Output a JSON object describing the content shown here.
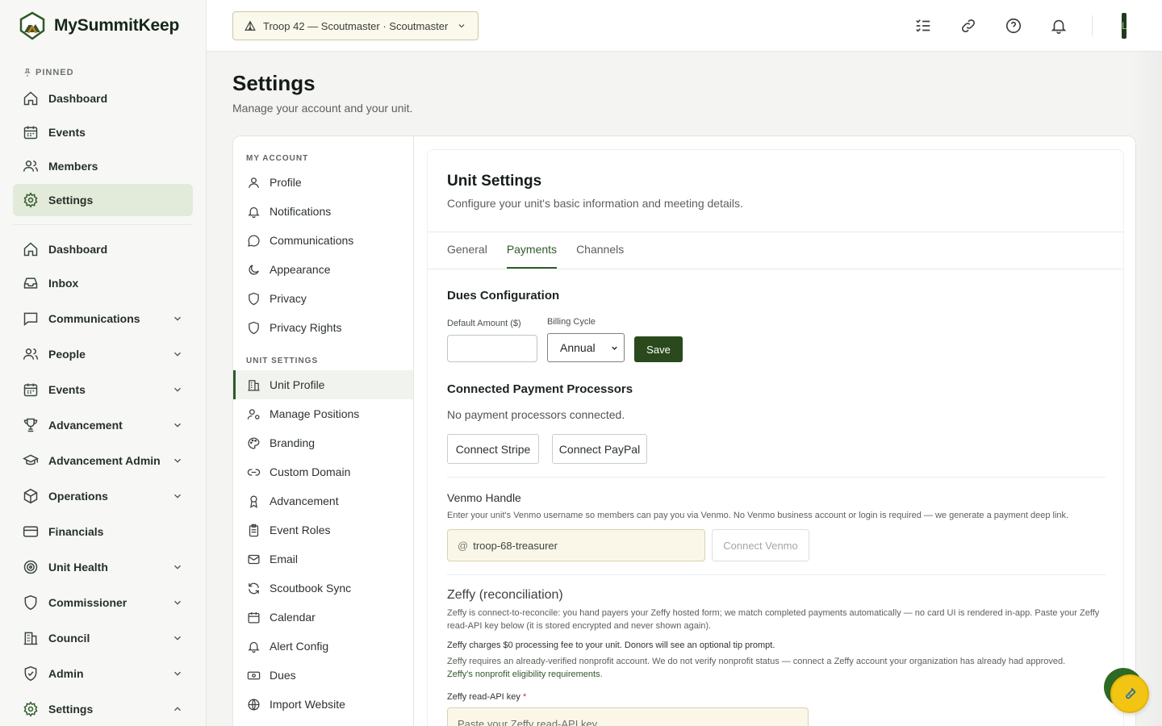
{
  "brand": {
    "name": "MySummitKeep"
  },
  "sidebar": {
    "pinned_label": "PINNED",
    "pinned": [
      {
        "label": "Dashboard",
        "icon": "home-icon"
      },
      {
        "label": "Events",
        "icon": "calendar-icon"
      },
      {
        "label": "Members",
        "icon": "users-icon"
      },
      {
        "label": "Settings",
        "icon": "gear-icon",
        "active": true
      }
    ],
    "items": [
      {
        "label": "Dashboard",
        "icon": "home-icon",
        "expandable": false
      },
      {
        "label": "Inbox",
        "icon": "inbox-icon",
        "expandable": false
      },
      {
        "label": "Communications",
        "icon": "message-icon",
        "expandable": true
      },
      {
        "label": "People",
        "icon": "users-icon",
        "expandable": true
      },
      {
        "label": "Events",
        "icon": "calendar-icon",
        "expandable": true
      },
      {
        "label": "Advancement",
        "icon": "trophy-icon",
        "expandable": true
      },
      {
        "label": "Advancement Admin",
        "icon": "graduation-cap-icon",
        "expandable": true
      },
      {
        "label": "Operations",
        "icon": "box-icon",
        "expandable": true
      },
      {
        "label": "Financials",
        "icon": "credit-card-icon",
        "expandable": false
      },
      {
        "label": "Unit Health",
        "icon": "target-icon",
        "expandable": true
      },
      {
        "label": "Commissioner",
        "icon": "shield-icon",
        "expandable": true
      },
      {
        "label": "Council",
        "icon": "building-icon",
        "expandable": true
      },
      {
        "label": "Admin",
        "icon": "shield-check-icon",
        "expandable": true
      },
      {
        "label": "Settings",
        "icon": "gear-icon",
        "expandable": true,
        "expanded": true
      }
    ]
  },
  "topbar": {
    "unit_selector": "Troop 42 — Scoutmaster · Scoutmaster",
    "icons": [
      "checklist-icon",
      "link-icon",
      "help-icon",
      "bell-icon"
    ],
    "avatar_initial": "L"
  },
  "page": {
    "title": "Settings",
    "subtitle": "Manage your account and your unit."
  },
  "settings_nav": {
    "my_account_label": "MY ACCOUNT",
    "my_account": [
      {
        "label": "Profile",
        "icon": "user-icon"
      },
      {
        "label": "Notifications",
        "icon": "bell-icon"
      },
      {
        "label": "Communications",
        "icon": "chat-bubble-icon"
      },
      {
        "label": "Appearance",
        "icon": "moon-icon"
      },
      {
        "label": "Privacy",
        "icon": "shield-icon"
      },
      {
        "label": "Privacy Rights",
        "icon": "shield-icon"
      }
    ],
    "unit_settings_label": "UNIT SETTINGS",
    "unit_settings": [
      {
        "label": "Unit Profile",
        "icon": "building-icon",
        "active": true
      },
      {
        "label": "Manage Positions",
        "icon": "user-cog-icon"
      },
      {
        "label": "Branding",
        "icon": "palette-icon"
      },
      {
        "label": "Custom Domain",
        "icon": "link-icon"
      },
      {
        "label": "Advancement",
        "icon": "award-icon"
      },
      {
        "label": "Event Roles",
        "icon": "clipboard-icon"
      },
      {
        "label": "Email",
        "icon": "mail-icon"
      },
      {
        "label": "Scoutbook Sync",
        "icon": "refresh-icon"
      },
      {
        "label": "Calendar",
        "icon": "calendar-icon"
      },
      {
        "label": "Alert Config",
        "icon": "bell-icon"
      },
      {
        "label": "Dues",
        "icon": "banknote-icon"
      },
      {
        "label": "Import Website",
        "icon": "globe-icon"
      }
    ]
  },
  "unit_settings": {
    "title": "Unit Settings",
    "subtitle": "Configure your unit's basic information and meeting details.",
    "tabs": [
      "General",
      "Payments",
      "Channels"
    ],
    "active_tab": "Payments",
    "dues": {
      "title": "Dues Configuration",
      "amount_label": "Default Amount ($)",
      "amount_value": "",
      "cycle_label": "Billing Cycle",
      "cycle_value": "Annual",
      "save_label": "Save"
    },
    "processors": {
      "title": "Connected Payment Processors",
      "empty_text": "No payment processors connected.",
      "stripe_label": "Connect Stripe",
      "paypal_label": "Connect PayPal"
    },
    "venmo": {
      "title": "Venmo Handle",
      "help": "Enter your unit's Venmo username so members can pay you via Venmo. No Venmo business account or login is required — we generate a payment deep link.",
      "prefix": "@",
      "value": "troop-68-treasurer",
      "connect_label": "Connect Venmo"
    },
    "zeffy": {
      "title": "Zeffy (reconciliation)",
      "desc": "Zeffy is connect-to-reconcile: you hand payers your Zeffy hosted form; we match completed payments automatically — no card UI is rendered in-app. Paste your Zeffy read-API key below (it is stored encrypted and never shown again).",
      "fee_note": "Zeffy charges $0 processing fee to your unit. Donors will see an optional tip prompt.",
      "nonprofit_note": "Zeffy requires an already-verified nonprofit account. We do not verify nonprofit status — connect a Zeffy account your organization has already had approved.",
      "eligibility_link": "Zeffy's nonprofit eligibility requirements",
      "key_label": "Zeffy read-API key",
      "required_mark": "*",
      "key_placeholder": "Paste your Zeffy read-API key"
    }
  },
  "colors": {
    "accent": "#2f5a2a",
    "save_button": "#2a4a1d",
    "fab_yellow": "#f2c515",
    "fab_green": "#2f6a25"
  }
}
